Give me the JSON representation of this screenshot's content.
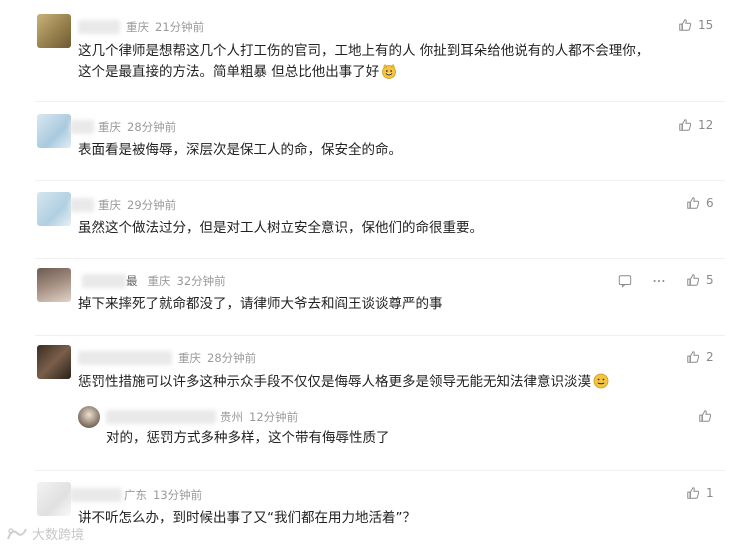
{
  "comments": [
    {
      "location": "重庆",
      "time": "21分钟前",
      "text_lines": [
        "这几个律师是想帮这几个人打工伤的官司，工地上有的人 你扯到耳朵给他说有的人都不会理你，",
        "这个是最直接的方法。简单粗暴 但总比他出事了好"
      ],
      "likes": "15",
      "emoji": "grin-cat-emoji"
    },
    {
      "location": "重庆",
      "time": "28分钟前",
      "text_lines": [
        "表面看是被侮辱，深层次是保工人的命，保安全的命。"
      ],
      "likes": "12"
    },
    {
      "location": "重庆",
      "time": "29分钟前",
      "text_lines": [
        "虽然这个做法过分，但是对工人树立安全意识，保他们的命很重要。"
      ],
      "likes": "6"
    },
    {
      "name_suffix": "最",
      "location": "重庆",
      "time": "32分钟前",
      "text_lines": [
        "掉下来摔死了就命都没了，请律师大爷去和阎王谈谈尊严的事"
      ],
      "likes": "5"
    },
    {
      "location": "重庆",
      "time": "28分钟前",
      "text_lines": [
        "惩罚性措施可以许多这种示众手段不仅仅是侮辱人格更多是领导无能无知法律意识淡漠"
      ],
      "likes": "2",
      "emoji": "smile-emoji"
    },
    {
      "location": "广东",
      "time": "13分钟前",
      "text_lines": [
        "讲不听怎么办，到时候出事了又“我们都在用力地活着”？"
      ],
      "likes": "1"
    }
  ],
  "reply": {
    "location": "贵州",
    "time": "12分钟前",
    "text": "对的，惩罚方式多种多样，这个带有侮辱性质了",
    "likes": ""
  },
  "watermark": {
    "text": "大数跨境"
  },
  "colors": {
    "meta": "#9a9a9a",
    "text": "#222222",
    "like": "#8a8a8a"
  }
}
